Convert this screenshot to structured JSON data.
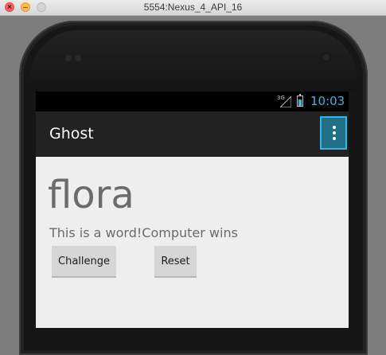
{
  "window": {
    "title": "5554:Nexus_4_API_16"
  },
  "status_bar": {
    "network": "3G",
    "time": "10:03"
  },
  "action_bar": {
    "title": "Ghost",
    "overflow_icon": "more-vert-icon"
  },
  "main": {
    "word": "flora",
    "status": "This is a word!Computer wins",
    "buttons": {
      "challenge": "Challenge",
      "reset": "Reset"
    }
  },
  "colors": {
    "accent": "#33b5e5",
    "action_bar": "#222222",
    "content_bg": "#eeeeee",
    "button_bg": "#d6d6d6"
  }
}
